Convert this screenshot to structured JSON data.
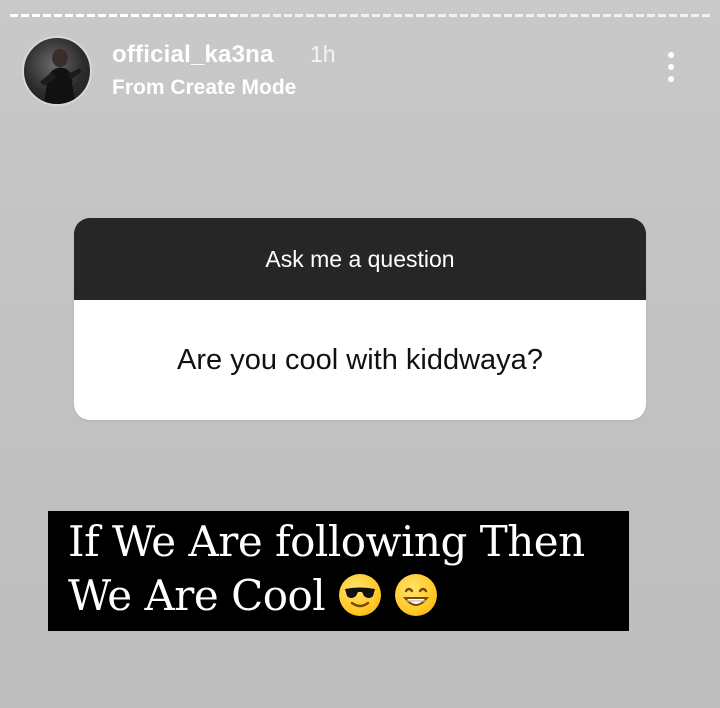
{
  "story": {
    "progress_segments": 2,
    "progress_current": 1
  },
  "header": {
    "username": "official_ka3na",
    "time": "1h",
    "subtitle": "From Create Mode",
    "more_icon": "more-vertical-icon"
  },
  "question_sticker": {
    "title": "Ask me a question",
    "question": "Are you cool with kiddwaya?"
  },
  "caption": {
    "line1": "If We Are following Then",
    "line2": "We Are Cool",
    "emojis": [
      "smiling-face-with-sunglasses-icon",
      "beaming-face-icon"
    ]
  },
  "colors": {
    "sticker_header": "#262626",
    "sticker_body": "#ffffff",
    "caption_bg": "#000000",
    "background": "#c4c4c4"
  }
}
